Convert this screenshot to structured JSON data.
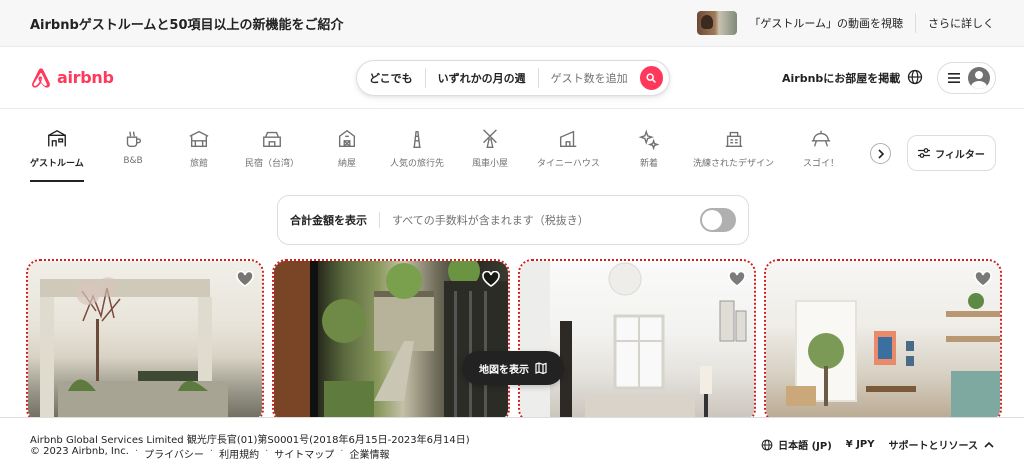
{
  "announcement": {
    "title": "Airbnbゲストルームと50項目以上の新機能をご紹介",
    "video_link": "「ゲストルーム」の動画を視聴",
    "learn_more": "さらに詳しく"
  },
  "header": {
    "logo_text": "airbnb",
    "search": {
      "where": "どこでも",
      "when": "いずれかの月の週",
      "guests": "ゲスト数を追加"
    },
    "host_link": "Airbnbにお部屋を掲載"
  },
  "categories": [
    {
      "label": "ゲストルーム",
      "icon": "guest-room-icon",
      "active": true
    },
    {
      "label": "B&B",
      "icon": "bnb-icon",
      "active": false
    },
    {
      "label": "旅館",
      "icon": "ryokan-icon",
      "active": false
    },
    {
      "label": "民宿（台湾）",
      "icon": "minshuku-icon",
      "active": false
    },
    {
      "label": "納屋",
      "icon": "barn-icon",
      "active": false
    },
    {
      "label": "人気の旅行先",
      "icon": "trending-icon",
      "active": false
    },
    {
      "label": "風車小屋",
      "icon": "windmill-icon",
      "active": false
    },
    {
      "label": "タイニーハウス",
      "icon": "tiny-house-icon",
      "active": false
    },
    {
      "label": "新着",
      "icon": "new-icon",
      "active": false
    },
    {
      "label": "洗練されたデザイン",
      "icon": "design-icon",
      "active": false
    },
    {
      "label": "スゴイ！",
      "icon": "omg-icon",
      "active": false
    }
  ],
  "filter_label": "フィルター",
  "price_toggle": {
    "label": "合計金額を表示",
    "description": "すべての手数料が含まれます（税抜き）"
  },
  "map_button": "地図を表示",
  "footer": {
    "license": "Airbnb Global Services Limited 観光庁長官(01)第S0001号(2018年6月15日-2023年6月14日)",
    "copyright": "© 2023 Airbnb, Inc.",
    "links": [
      "プライバシー",
      "利用規約",
      "サイトマップ",
      "企業情報"
    ],
    "language": "日本語 (JP)",
    "currency": "¥ JPY",
    "support": "サポートとリソース"
  },
  "colors": {
    "brand": "#ff385c",
    "text": "#222222",
    "muted": "#717171"
  }
}
